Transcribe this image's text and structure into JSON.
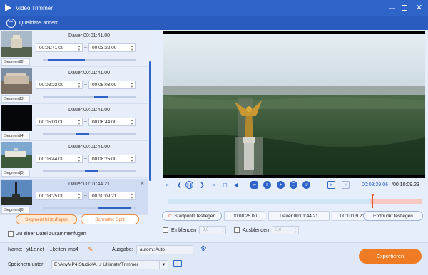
{
  "window": {
    "title": "Video Trimmer"
  },
  "toolbar": {
    "source_label": "Quelldatei ändern"
  },
  "segments": [
    {
      "label": "Segment[2]",
      "duration": "Dauer:00:01:41.00",
      "start": "00:01:41.00",
      "end": "00:03:22.00"
    },
    {
      "label": "Segment[3]",
      "duration": "Dauer:00:01:41.00",
      "start": "00:03:22.00",
      "end": "00:05:03.00"
    },
    {
      "label": "Segment[4]",
      "duration": "Dauer:00:01:41.00",
      "start": "00:05:03.00",
      "end": "00:06:44.00"
    },
    {
      "label": "Segment[5]",
      "duration": "Dauer:00:01:41.00",
      "start": "00:06:44.00",
      "end": "00:08:25.00"
    },
    {
      "label": "Segment[6]",
      "duration": "Dauer:00:01:44.21",
      "start": "00:08:25.00",
      "end": "00:10:09.21"
    }
  ],
  "buttons": {
    "add_segment": "Segment hinzufügen",
    "fast_split": "Schneller Split",
    "export": "Exportieren"
  },
  "merge": {
    "label": "Zu einer Datei zusammenfügen"
  },
  "player": {
    "current_time": "00:08:29.06",
    "total_time": "/00:10:09.23"
  },
  "cut": {
    "set_start": "Startpunkt festlegen",
    "start": "00:08:25.00",
    "duration": "Dauer:00:01:44.21",
    "end": "00:10:09.21",
    "set_end": "Endpunkt festlegen"
  },
  "fade": {
    "in_label": "Einblenden",
    "in_value": "3,0",
    "out_label": "Ausblenden",
    "out_value": "3,0"
  },
  "bottom": {
    "name_label": "Name:",
    "name_value": "yt1z.net - ...keiten .mp4",
    "output_label": "Ausgabe:",
    "output_value": "autom.;Auto",
    "save_label": "Speichern unter:",
    "save_value": "E:\\AnyMP4 Studio\\A...r Ultimate\\Trimmer"
  },
  "colors": {
    "accent": "#2e63c8",
    "export": "#f07b25"
  }
}
